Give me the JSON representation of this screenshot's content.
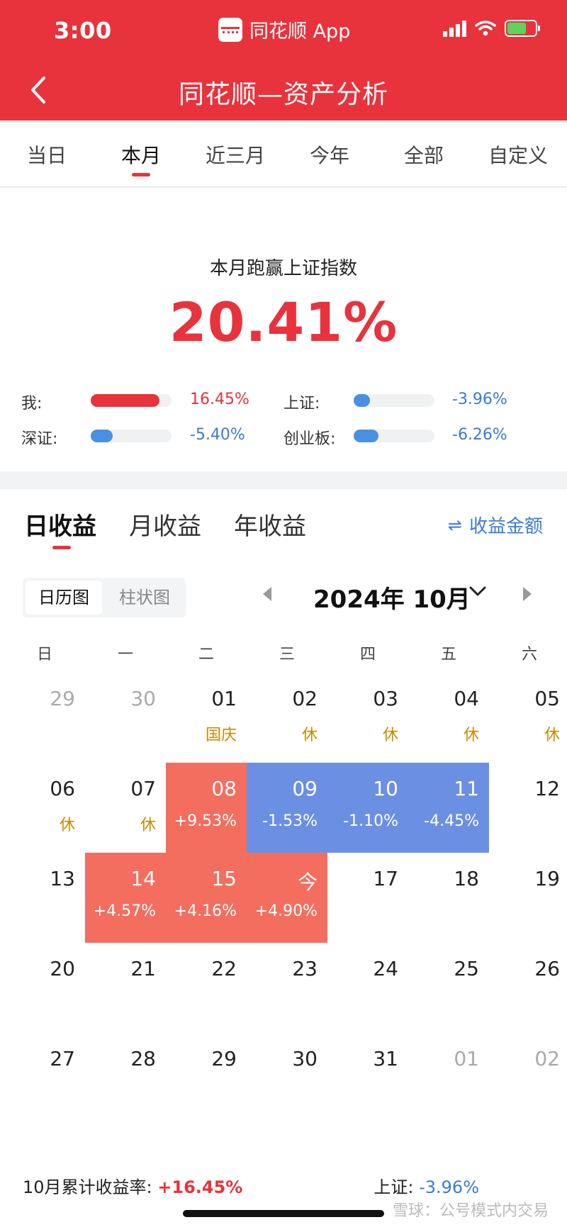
{
  "status": {
    "time": "3:00",
    "app": "同花顺 App"
  },
  "header": {
    "title": "同花顺—资产分析"
  },
  "tabs": [
    "当日",
    "本月",
    "近三月",
    "今年",
    "全部",
    "自定义"
  ],
  "summary": {
    "label": "本月跑赢上证指数",
    "value": "20.41%",
    "compare": [
      {
        "label": "我:",
        "value": "16.45%",
        "bar_fraction": 0.85,
        "color": "#e8333c",
        "value_color": "#e8333c"
      },
      {
        "label": "上证:",
        "value": "-3.96%",
        "bar_fraction": 0.2,
        "color": "#4a90e2",
        "value_color": "#3a7bd5"
      },
      {
        "label": "深证:",
        "value": "-5.40%",
        "bar_fraction": 0.27,
        "color": "#4a90e2",
        "value_color": "#3a7bd5"
      },
      {
        "label": "创业板:",
        "value": "-6.26%",
        "bar_fraction": 0.31,
        "color": "#4a90e2",
        "value_color": "#3a7bd5"
      }
    ]
  },
  "returns": {
    "tabs": [
      "日收益",
      "月收益",
      "年收益"
    ],
    "amount_toggle": "收益金额",
    "view_switch": [
      "日历图",
      "柱状图"
    ],
    "month": "2024年 10月"
  },
  "calendar": {
    "weekdays": [
      "日",
      "一",
      "二",
      "三",
      "四",
      "五",
      "六"
    ],
    "weeks": [
      [
        {
          "d": "29",
          "muted": true
        },
        {
          "d": "30",
          "muted": true
        },
        {
          "d": "01",
          "s": "国庆"
        },
        {
          "d": "02",
          "s": "休"
        },
        {
          "d": "03",
          "s": "休"
        },
        {
          "d": "04",
          "s": "休"
        },
        {
          "d": "05",
          "s": "休"
        }
      ],
      [
        {
          "d": "06",
          "s": "休"
        },
        {
          "d": "07",
          "s": "休"
        },
        {
          "d": "08",
          "s": "+9.53%",
          "type": "up"
        },
        {
          "d": "09",
          "s": "-1.53%",
          "type": "down"
        },
        {
          "d": "10",
          "s": "-1.10%",
          "type": "down"
        },
        {
          "d": "11",
          "s": "-4.45%",
          "type": "down"
        },
        {
          "d": "12"
        }
      ],
      [
        {
          "d": "13"
        },
        {
          "d": "14",
          "s": "+4.57%",
          "type": "up"
        },
        {
          "d": "15",
          "s": "+4.16%",
          "type": "up"
        },
        {
          "d": "今",
          "s": "+4.90%",
          "type": "up"
        },
        {
          "d": "17"
        },
        {
          "d": "18"
        },
        {
          "d": "19"
        }
      ],
      [
        {
          "d": "20"
        },
        {
          "d": "21"
        },
        {
          "d": "22"
        },
        {
          "d": "23"
        },
        {
          "d": "24"
        },
        {
          "d": "25"
        },
        {
          "d": "26"
        }
      ],
      [
        {
          "d": "27"
        },
        {
          "d": "28"
        },
        {
          "d": "29"
        },
        {
          "d": "30"
        },
        {
          "d": "31"
        },
        {
          "d": "01",
          "muted": true
        },
        {
          "d": "02",
          "muted": true
        }
      ]
    ]
  },
  "footer": {
    "left_label": "10月累计收益率:",
    "left_value": "+16.45%",
    "right_label": "上证:",
    "right_value": "-3.96%",
    "watermark": "雪球：公号模式内交易"
  },
  "colors": {
    "brand": "#e8333c",
    "up": "#f36e5e",
    "down": "#6b8fe3",
    "blue_text": "#3a7bd5"
  }
}
